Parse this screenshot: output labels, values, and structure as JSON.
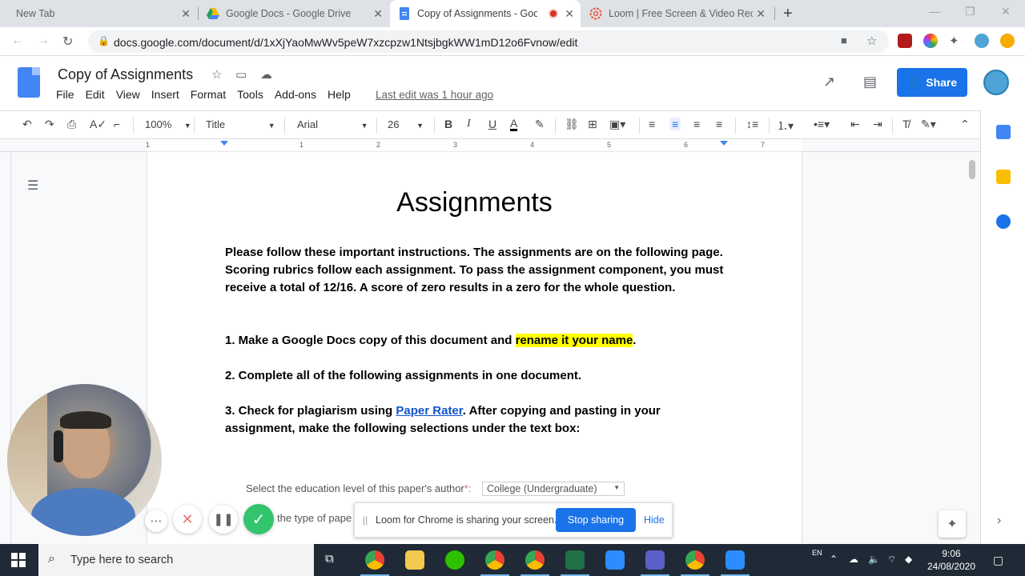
{
  "browser": {
    "tabs": [
      {
        "title": "New Tab"
      },
      {
        "title": "Google Docs - Google Drive"
      },
      {
        "title": "Copy of Assignments - Goo"
      },
      {
        "title": "Loom | Free Screen & Video Reco"
      }
    ],
    "url": "docs.google.com/document/d/1xXjYaoMwWv5peW7xzcpzw1NtsjbgkWW1mD12o6Fvnow/edit"
  },
  "docs": {
    "title": "Copy of Assignments",
    "menu": [
      "File",
      "Edit",
      "View",
      "Insert",
      "Format",
      "Tools",
      "Add-ons",
      "Help"
    ],
    "last_edit": "Last edit was 1 hour ago",
    "share_label": "Share"
  },
  "toolbar": {
    "zoom": "100%",
    "style": "Title",
    "font": "Arial",
    "size": "26"
  },
  "ruler": [
    "1",
    "1",
    "2",
    "3",
    "4",
    "5",
    "6",
    "7"
  ],
  "document": {
    "heading": "Assignments",
    "intro": "Please follow these important instructions. The assignments are on the following page. Scoring rubrics follow each assignment. To pass the assignment component, you must receive a total of 12/16. A score of zero results in a zero for the whole question.",
    "step1_pre": "1. Make a Google Docs copy of this document and ",
    "step1_hl": "rename it your name",
    "step1_post": ".",
    "step2": "2. Complete all of the following assignments in one document.",
    "step3_pre": "3. Check for plagiarism using ",
    "step3_link": "Paper Rater",
    "step3_post": ". After copying and pasting in your assignment, make the following selections under the text box:",
    "form_label1": "Select the education level of this paper's author",
    "form_req": "*:",
    "form_value1": "College (Undergraduate)",
    "form_label2_partial": "the type of pape"
  },
  "loom": {
    "sharing_msg": "Loom for Chrome is sharing your screen.",
    "stop_label": "Stop sharing",
    "hide_label": "Hide"
  },
  "taskbar": {
    "search_placeholder": "Type here to search",
    "lang": "EN",
    "time": "9:06",
    "date": "24/08/2020"
  }
}
